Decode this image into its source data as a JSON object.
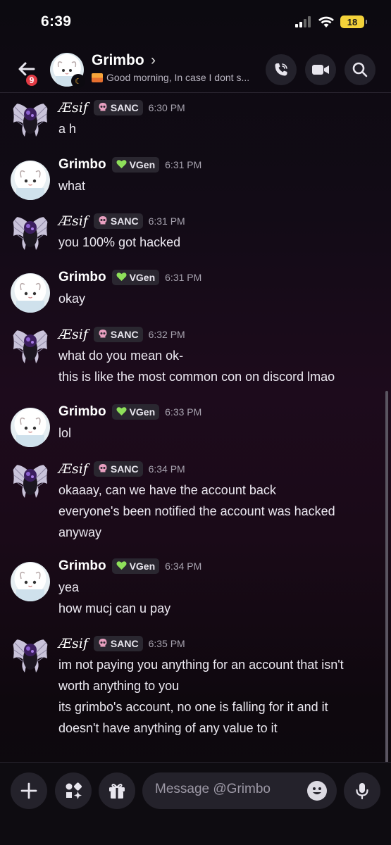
{
  "status_bar": {
    "time": "6:39",
    "battery": "18"
  },
  "header": {
    "notification_count": "9",
    "name": "Grimbo",
    "chevron": "›",
    "status_text": "Good morning, In case I dont s..."
  },
  "messages": [
    {
      "user": "Æsif",
      "tag_icon": "skull-icon",
      "tag": "SANC",
      "time": "6:30 PM",
      "lines": [
        "a h"
      ]
    },
    {
      "user": "Grimbo",
      "tag_icon": "heart-icon",
      "tag": "VGen",
      "time": "6:31 PM",
      "lines": [
        "what"
      ]
    },
    {
      "user": "Æsif",
      "tag_icon": "skull-icon",
      "tag": "SANC",
      "time": "6:31 PM",
      "lines": [
        "you 100% got hacked"
      ]
    },
    {
      "user": "Grimbo",
      "tag_icon": "heart-icon",
      "tag": "VGen",
      "time": "6:31 PM",
      "lines": [
        "okay"
      ]
    },
    {
      "user": "Æsif",
      "tag_icon": "skull-icon",
      "tag": "SANC",
      "time": "6:32 PM",
      "lines": [
        "what do you mean ok-",
        "this is like the most common con on discord lmao"
      ]
    },
    {
      "user": "Grimbo",
      "tag_icon": "heart-icon",
      "tag": "VGen",
      "time": "6:33 PM",
      "lines": [
        "lol"
      ]
    },
    {
      "user": "Æsif",
      "tag_icon": "skull-icon",
      "tag": "SANC",
      "time": "6:34 PM",
      "lines": [
        "okaaay, can we have the account back",
        "everyone's been notified the account was hacked",
        "anyway"
      ]
    },
    {
      "user": "Grimbo",
      "tag_icon": "heart-icon",
      "tag": "VGen",
      "time": "6:34 PM",
      "lines": [
        "yea",
        "how mucj can u pay"
      ]
    },
    {
      "user": "Æsif",
      "tag_icon": "skull-icon",
      "tag": "SANC",
      "time": "6:35 PM",
      "lines": [
        "im not paying you anything for an account that isn't",
        "worth anything to you",
        "its grimbo's account, no one is falling for it and it",
        "doesn't have anything of any value to it"
      ]
    }
  ],
  "composer": {
    "placeholder": "Message @Grimbo"
  },
  "colors": {
    "background": "#120b16",
    "badge": "#e23b45",
    "vgen_heart": "#8ee05a",
    "skull": "#e8a0c0"
  }
}
